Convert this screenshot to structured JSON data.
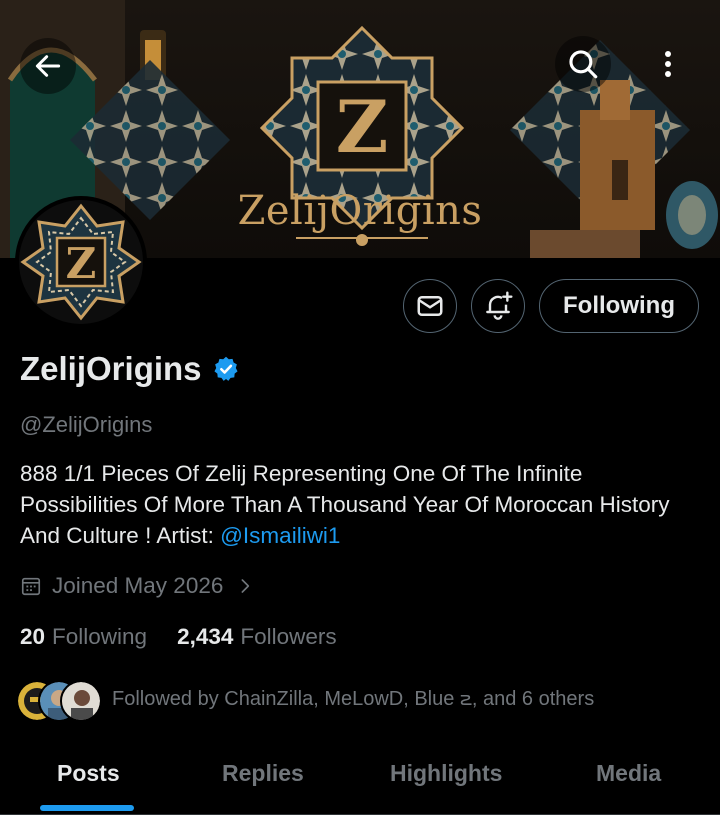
{
  "banner": {
    "title": "ZelijOrigins",
    "emblem_letter": "Z"
  },
  "nav": {
    "back_icon": "arrow-left-icon",
    "search_icon": "search-icon",
    "more_icon": "more-vertical-icon"
  },
  "profile": {
    "avatar_letter": "Z",
    "display_name": "ZelijOrigins",
    "verified": true,
    "handle": "@ZelijOrigins",
    "bio_text": "888 1/1 Pieces Of Zelij Representing One Of The Infinite Possibilities Of More Than A Thousand Year Of Moroccan History And Culture !  Artist: ",
    "bio_mention": "@Ismailiwi1",
    "joined": "Joined May 2026",
    "following_count": "20",
    "following_label": "Following",
    "followers_count": "2,434",
    "followers_label": "Followers",
    "followed_by": "Followed by ChainZilla, MeLowD, Blue ౽, and 6 others"
  },
  "actions": {
    "message_icon": "envelope-icon",
    "notify_icon": "bell-plus-icon",
    "following_button": "Following"
  },
  "tabs": [
    {
      "label": "Posts",
      "active": true
    },
    {
      "label": "Replies",
      "active": false
    },
    {
      "label": "Highlights",
      "active": false
    },
    {
      "label": "Media",
      "active": false
    }
  ],
  "colors": {
    "accent": "#1d9bf0",
    "secondary_text": "#71767b",
    "banner_gold": "#c9a063"
  }
}
